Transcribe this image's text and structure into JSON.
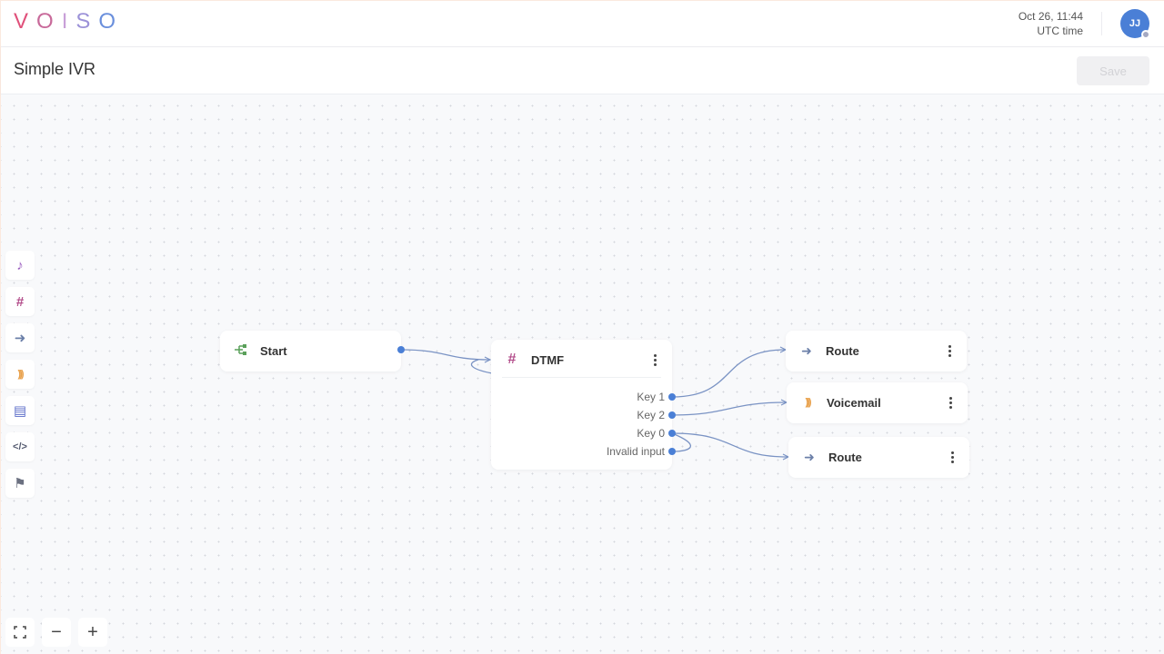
{
  "brand": {
    "logo_letters": [
      {
        "char": "V",
        "color": "#e0507a"
      },
      {
        "char": "O",
        "color": "#c86a9a"
      },
      {
        "char": "I",
        "color": "#c9a0d8"
      },
      {
        "char": "S",
        "color": "#9c92d8"
      },
      {
        "char": "O",
        "color": "#6a8fdc"
      }
    ]
  },
  "header": {
    "date": "Oct 26, 11:44",
    "timezone": "UTC time",
    "avatar_initials": "JJ"
  },
  "titlebar": {
    "title": "Simple IVR",
    "save_label": "Save"
  },
  "toolbox": [
    {
      "name": "play-audio-tool",
      "icon": "music-note-icon",
      "glyph": "♪",
      "color": "#9b5fc0"
    },
    {
      "name": "dtmf-tool",
      "icon": "hash-icon",
      "glyph": "#",
      "color": "#b24c8a"
    },
    {
      "name": "route-tool",
      "icon": "arrow-right-icon",
      "glyph": "➜",
      "color": "#6b7fa8"
    },
    {
      "name": "voicemail-tool",
      "icon": "voicemail-waves-icon",
      "glyph": ")))",
      "color": "#e8a04a"
    },
    {
      "name": "sms-tool",
      "icon": "message-icon",
      "glyph": "▤",
      "color": "#5b6cc8"
    },
    {
      "name": "code-tool",
      "icon": "code-icon",
      "glyph": "</>",
      "color": "#555b70"
    },
    {
      "name": "finish-tool",
      "icon": "flag-icon",
      "glyph": "⚑",
      "color": "#6b7080"
    }
  ],
  "nodes": {
    "start": {
      "title": "Start",
      "icon_color": "#5aa05a"
    },
    "dtmf": {
      "title": "DTMF",
      "icon_color": "#b24c8a",
      "keys": [
        "Key 1",
        "Key 2",
        "Key 0",
        "Invalid input"
      ]
    },
    "route1": {
      "title": "Route",
      "icon_color": "#6b7fa8"
    },
    "voicemail": {
      "title": "Voicemail",
      "icon_color": "#e8a04a"
    },
    "route2": {
      "title": "Route",
      "icon_color": "#6b7fa8"
    }
  },
  "zoom_controls": {
    "fit": "⛶",
    "zoom_out": "−",
    "zoom_in": "+"
  },
  "colors": {
    "accent": "#4a7fd6",
    "edge": "#7a93c4"
  }
}
